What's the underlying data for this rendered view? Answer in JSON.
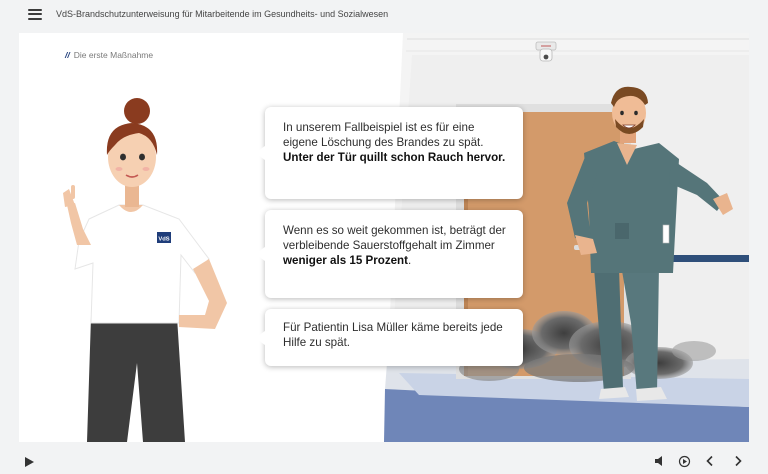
{
  "header": {
    "menu_icon": "hamburger-menu-icon",
    "title": "VdS-Brandschutzunterweisung für Mitarbeitende im Gesundheits- und Sozialwesen"
  },
  "slide": {
    "section_marker": "//",
    "section_label": "Die erste Maßnahme",
    "badge_text": "VdS",
    "bubbles": [
      {
        "text": "In unserem Fallbeispiel ist es für eine eigene Löschung des Brandes zu spät. ",
        "bold": "Unter der Tür quillt schon Rauch hervor.",
        "after": ""
      },
      {
        "text": "Wenn es so weit gekommen ist, beträgt der verbleibende Sauerstoffgehalt im Zimmer ",
        "bold": "weniger als 15 Prozent",
        "after": "."
      },
      {
        "text": "Für Patientin Lisa Müller käme bereits jede Hilfe zu spät.",
        "bold": "",
        "after": ""
      }
    ]
  },
  "player": {
    "play_icon": "play-icon",
    "volume_icon": "volume-icon",
    "replay_icon": "replay-icon",
    "prev_icon": "chevron-left-icon",
    "next_icon": "chevron-right-icon"
  },
  "colors": {
    "accent": "#1f3d7a",
    "door": "#d39a6a",
    "scrubs": "#4f6e73",
    "smoke": "#5a5a5a"
  }
}
